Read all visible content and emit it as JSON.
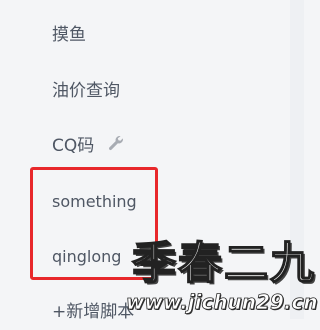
{
  "menu": {
    "items": [
      {
        "label": "摸鱼"
      },
      {
        "label": "油价查询"
      },
      {
        "label": "CQ码",
        "icon": "wrench-icon"
      },
      {
        "label": "something"
      },
      {
        "label": "qinglong"
      },
      {
        "label": "+新增脚本"
      }
    ]
  },
  "highlight": {
    "color": "#e8282b"
  },
  "watermark": {
    "text": "季春二九",
    "url": "www.jichun29.cn"
  }
}
